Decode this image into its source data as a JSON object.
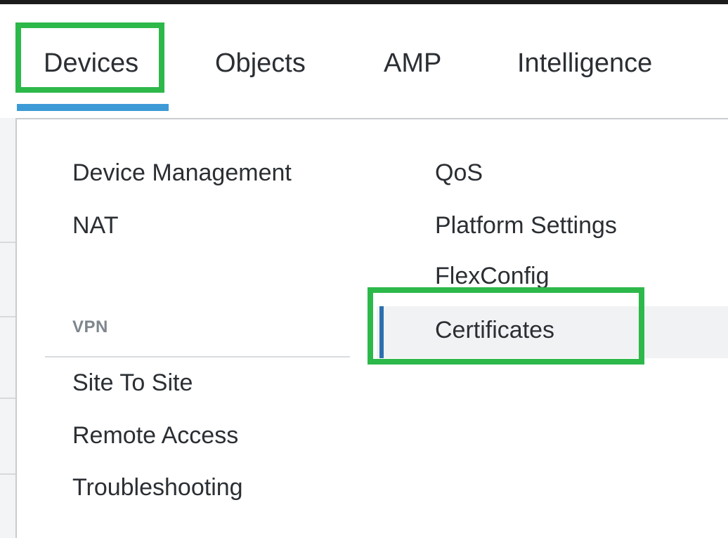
{
  "nav": {
    "items": [
      "Devices",
      "Objects",
      "AMP",
      "Intelligence"
    ],
    "active": "Devices"
  },
  "menu": {
    "col1": [
      "Device Management",
      "NAT"
    ],
    "vpn_section_title": "VPN",
    "vpn_items": [
      "Site To Site",
      "Remote Access",
      "Troubleshooting"
    ],
    "col2": [
      "QoS",
      "Platform Settings",
      "FlexConfig",
      "Certificates"
    ]
  },
  "colors": {
    "highlight": "#2db84a",
    "active_underline": "#3d9ad6",
    "selected_bar": "#2c6fb0"
  }
}
